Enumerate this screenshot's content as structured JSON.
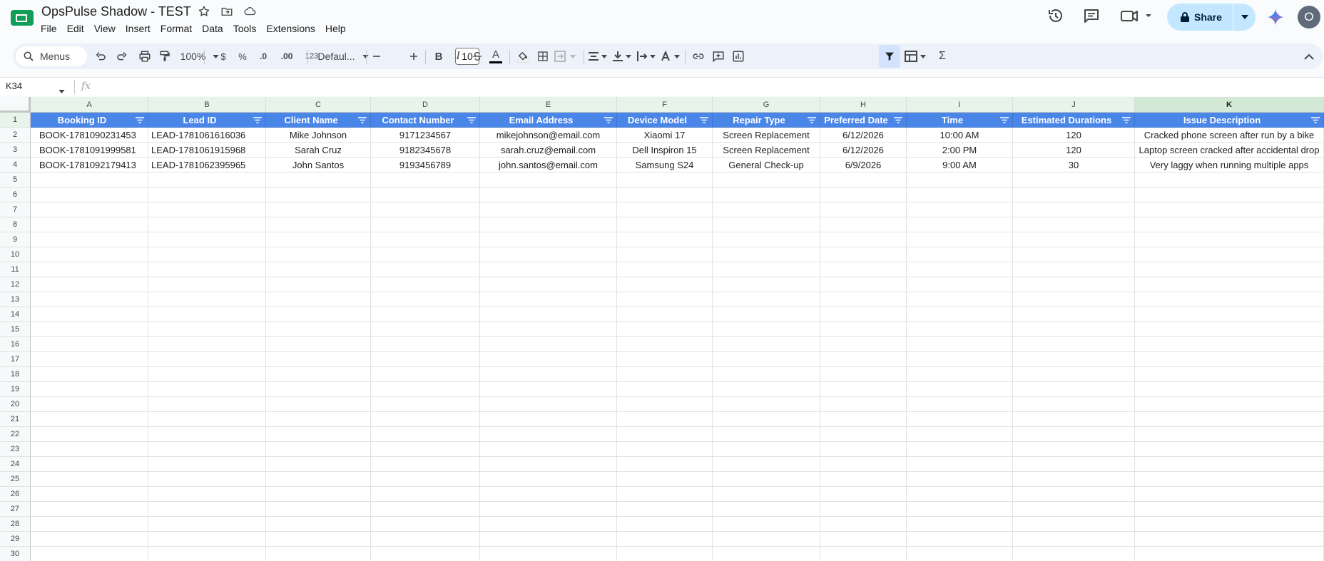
{
  "doc": {
    "title": "OpsPulse Shadow - TEST"
  },
  "menu": [
    "File",
    "Edit",
    "View",
    "Insert",
    "Format",
    "Data",
    "Tools",
    "Extensions",
    "Help"
  ],
  "header": {
    "share_label": "Share",
    "avatar_initial": "O"
  },
  "toolbar": {
    "menus_label": "Menus",
    "zoom": "100%",
    "currency": "$",
    "percent": "%",
    "decrease_decimal": ".0",
    "increase_decimal": ".00",
    "number_format": "123",
    "font": "Defaul...",
    "font_size": "10",
    "bold": "B",
    "italic": "I",
    "text_color_glyph": "A",
    "sum": "Σ"
  },
  "formula_bar": {
    "cell_ref": "K34",
    "fx": "fx",
    "value": ""
  },
  "columns": [
    "A",
    "B",
    "C",
    "D",
    "E",
    "F",
    "G",
    "H",
    "I",
    "J",
    "K"
  ],
  "table": {
    "headers": [
      "Booking ID",
      "Lead ID",
      "Client Name",
      "Contact Number",
      "Email Address",
      "Device Model",
      "Repair Type",
      "Preferred Date",
      "Time",
      "Estimated Durations",
      "Issue Description"
    ],
    "rows": [
      [
        "BOOK-1781090231453",
        "LEAD-1781061616036",
        "Mike Johnson",
        "9171234567",
        "mikejohnson@email.com",
        "Xiaomi 17",
        "Screen Replacement",
        "6/12/2026",
        "10:00 AM",
        "120",
        "Cracked phone screen after run by a bike"
      ],
      [
        "BOOK-1781091999581",
        "LEAD-1781061915968",
        "Sarah Cruz",
        "9182345678",
        "sarah.cruz@email.com",
        "Dell Inspiron 15",
        "Screen Replacement",
        "6/12/2026",
        "2:00 PM",
        "120",
        "Laptop screen cracked after accidental drop"
      ],
      [
        "BOOK-1781092179413",
        "LEAD-1781062395965",
        "John Santos",
        "9193456789",
        "john.santos@email.com",
        "Samsung S24",
        "General Check-up",
        "6/9/2026",
        "9:00 AM",
        "30",
        "Very laggy when running multiple apps"
      ]
    ]
  },
  "row_numbers": [
    "1",
    "2",
    "3",
    "4",
    "5",
    "6",
    "7",
    "8",
    "9",
    "10",
    "11",
    "12",
    "13",
    "14",
    "15",
    "16",
    "17",
    "18",
    "19",
    "20",
    "21",
    "22",
    "23",
    "24",
    "25",
    "26",
    "27",
    "28",
    "29",
    "30"
  ],
  "colors": {
    "header_fill": "#4a86e8",
    "share_bg": "#c2e7ff",
    "sheets_green": "#0f9d58"
  }
}
